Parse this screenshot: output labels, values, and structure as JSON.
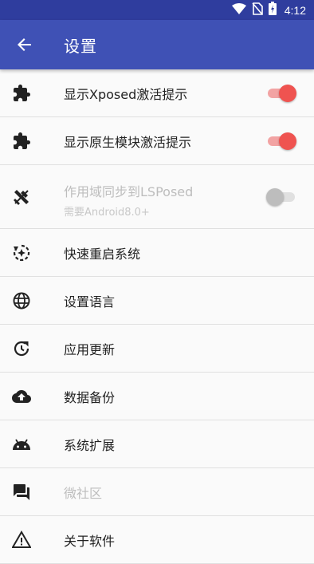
{
  "status_bar": {
    "time": "4:12"
  },
  "app_bar": {
    "title": "设置"
  },
  "settings": [
    {
      "label": "显示Xposed激活提示",
      "icon": "puzzle-icon",
      "switch": "on"
    },
    {
      "label": "显示原生模块激活提示",
      "icon": "puzzle-icon",
      "switch": "on"
    },
    {
      "label": "作用域同步到LSPosed",
      "sub": "需要Android8.0+",
      "icon": "tools-icon",
      "switch": "off",
      "disabled": true
    },
    {
      "label": "快速重启系统",
      "icon": "restart-icon"
    },
    {
      "label": "设置语言",
      "icon": "globe-icon"
    },
    {
      "label": "应用更新",
      "icon": "update-icon"
    },
    {
      "label": "数据备份",
      "icon": "cloud-upload-icon"
    },
    {
      "label": "系统扩展",
      "icon": "android-icon"
    },
    {
      "label": "微社区",
      "icon": "forum-icon",
      "disabled": true
    },
    {
      "label": "关于软件",
      "icon": "warning-icon"
    }
  ],
  "colors": {
    "primary": "#3f51b5",
    "primary_dark": "#2f3d9e",
    "accent": "#ef5350"
  }
}
